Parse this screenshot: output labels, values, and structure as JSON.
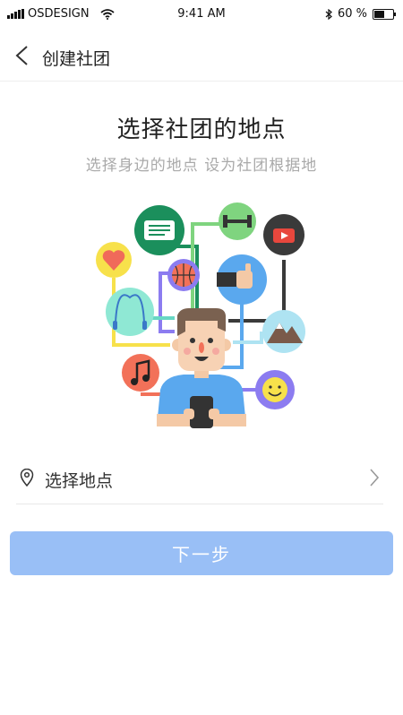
{
  "status_bar": {
    "carrier": "OSDESIGN",
    "time": "9:41 AM",
    "battery_text": "60 %",
    "battery_level": 0.6,
    "icons": [
      "signal-icon",
      "wifi-icon",
      "bluetooth-icon",
      "battery-icon"
    ]
  },
  "nav": {
    "title": "创建社团",
    "back_icon": "chevron-left-icon"
  },
  "main": {
    "title": "选择社团的地点",
    "subtitle": "选择身边的地点  设为社团根据地",
    "illustration_icons": [
      "chat-icon",
      "dumbbell-icon",
      "video-play-icon",
      "heart-icon",
      "basketball-icon",
      "thumbs-up-icon",
      "jump-rope-icon",
      "mountain-icon",
      "music-note-icon",
      "smiley-icon",
      "person-illustration"
    ]
  },
  "location": {
    "label": "选择地点",
    "icon": "location-pin-icon",
    "chevron_icon": "chevron-right-icon"
  },
  "next_button": {
    "label": "下一步"
  },
  "colors": {
    "primary_button": "#99bff6",
    "subtitle": "#a9a9a9",
    "divider": "#e8e8e8"
  }
}
